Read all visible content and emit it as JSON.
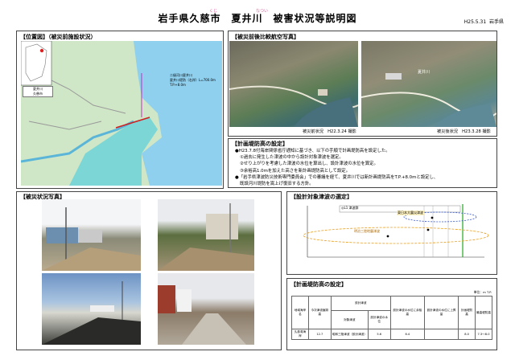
{
  "header": {
    "title": "岩手県久慈市　夏井川　被害状況等説明図",
    "ruby_kuji": "くじ",
    "ruby_natsui": "なつい",
    "date": "H25.5.31",
    "org": "岩手県"
  },
  "location_panel": {
    "title": "【位置図】（被災前施設状況）",
    "inset_label": "夏井川\n久慈市",
    "map_annotation": "二級河川夏井川\n夏井川堤防（右岸）L=700.0m\nT.P.+8.0m"
  },
  "aerial_panel": {
    "title": "【被災前後比較航空写真】",
    "before_caption": "被災前状況　H22.3.24 撮影",
    "after_caption": "被災後状況　H23.3.28 撮影",
    "photo_label": "夏井川"
  },
  "levee_setting": {
    "title": "【計画堤防高の設定】",
    "lines": [
      "●H23.7.8付海岸関係省庁通知に基づき、以下の手順で計画堤防高を設定した。",
      "①過去に発生した津波の中から設計対象津波を選定。",
      "②せり上がりを考慮した津波の水位を算出し、設計津波の水位を算定。",
      "③余裕高1.0mを加えた高さを新計画堤防高として設定。",
      "●「岩手県津波防災技術専門委員会」での審議を経て、夏井川では新計画堤防高をT.P.+8.0mと設定し、",
      "既設河川堤防を嵩上げ復旧する方針。"
    ]
  },
  "damage_panel": {
    "title": "【被災状況写真】"
  },
  "tsunami_chart": {
    "title": "【設計対象津波の選定】",
    "box_label": "◎L1 津波群",
    "label_upper": "東日本大震災津波",
    "label_lower": "明治三陸地震津波"
  },
  "height_table": {
    "title": "【計画堤防高の設定】",
    "unit": "単位：m T.P.",
    "headers": [
      "地域海岸名",
      "今次津波痕跡高",
      "設計津波",
      "対象津波",
      "設計津波の水位",
      "設計津波の水位に余裕高",
      "設計津波の水位に上昇量",
      "計画堤防高",
      "最高堤防高"
    ],
    "row": [
      "久慈湾海岸",
      "12.7",
      "昭和三陸津波（設計津波）",
      "5.6",
      "6.4",
      "",
      "",
      "8.0",
      "7.3〜8.0"
    ]
  }
}
